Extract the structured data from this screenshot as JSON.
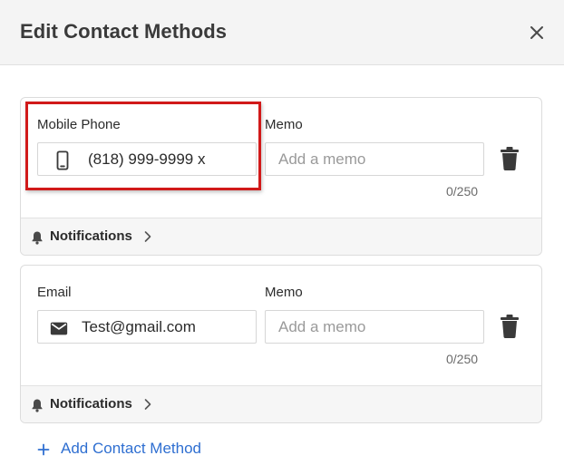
{
  "dialog": {
    "title": "Edit Contact Methods",
    "close_icon": "close-icon"
  },
  "contacts": [
    {
      "type_label": "Mobile Phone",
      "value": "(818) 999-9999 x",
      "icon": "mobile-phone-icon",
      "memo_label": "Memo",
      "memo_placeholder": "Add a memo",
      "memo_value": "",
      "memo_count": "0/250",
      "notifications_label": "Notifications"
    },
    {
      "type_label": "Email",
      "value": "Test@gmail.com",
      "icon": "envelope-icon",
      "memo_label": "Memo",
      "memo_placeholder": "Add a memo",
      "memo_value": "",
      "memo_count": "0/250",
      "notifications_label": "Notifications"
    }
  ],
  "add_contact_label": "Add Contact Method",
  "colors": {
    "accent": "#2f6fd1",
    "highlight": "#d11a1a"
  }
}
